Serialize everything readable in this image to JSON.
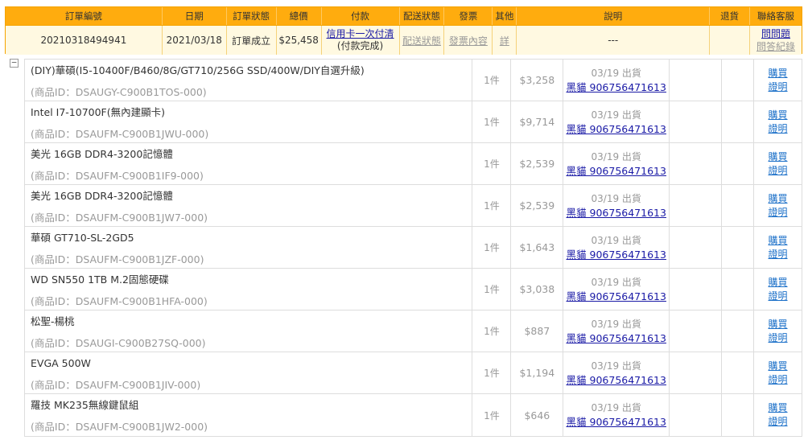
{
  "header": {
    "columns": [
      "訂單編號",
      "日期",
      "訂單狀態",
      "總價",
      "付款",
      "配送狀態",
      "發票",
      "其他",
      "說明",
      "退貨",
      "聯絡客服"
    ],
    "order": {
      "id": "20210318494941",
      "date": "2021/03/18",
      "status": "訂單成立",
      "total": "$25,458",
      "payment_link": "信用卡一次付清",
      "payment_status": "(付款完成)",
      "shipping_link": "配送狀態",
      "invoice_link": "發票內容",
      "other_link": "詳",
      "note": "---",
      "return": "",
      "contact_ask": "問問題",
      "contact_log": "問答紀錄"
    }
  },
  "toggle_symbol": "−",
  "items": [
    {
      "name": "(DIY)華碩(I5-10400F/B460/8G/GT710/256G SSD/400W/DIY自選升級)",
      "sku": "(商品ID：DSAUGY-C900B1TOS-000)",
      "qty": "1件",
      "price": "$3,258",
      "ship_date": "03/19 出貨",
      "tracking": "黑貓 906756471613",
      "buy_again": "購買",
      "proof": "證明"
    },
    {
      "name": "Intel I7-10700F(無內建顯卡)",
      "sku": "(商品ID：DSAUFM-C900B1JWU-000)",
      "qty": "1件",
      "price": "$9,714",
      "ship_date": "03/19 出貨",
      "tracking": "黑貓 906756471613",
      "buy_again": "購買",
      "proof": "證明"
    },
    {
      "name": "美光 16GB DDR4-3200記憶體",
      "sku": "(商品ID：DSAUFM-C900B1IF9-000)",
      "qty": "1件",
      "price": "$2,539",
      "ship_date": "03/19 出貨",
      "tracking": "黑貓 906756471613",
      "buy_again": "購買",
      "proof": "證明"
    },
    {
      "name": "美光 16GB DDR4-3200記憶體",
      "sku": "(商品ID：DSAUFM-C900B1JW7-000)",
      "qty": "1件",
      "price": "$2,539",
      "ship_date": "03/19 出貨",
      "tracking": "黑貓 906756471613",
      "buy_again": "購買",
      "proof": "證明"
    },
    {
      "name": "華碩 GT710-SL-2GD5",
      "sku": "(商品ID：DSAUFM-C900B1JZF-000)",
      "qty": "1件",
      "price": "$1,643",
      "ship_date": "03/19 出貨",
      "tracking": "黑貓 906756471613",
      "buy_again": "購買",
      "proof": "證明"
    },
    {
      "name": "WD SN550 1TB M.2固態硬碟",
      "sku": "(商品ID：DSAUFM-C900B1HFA-000)",
      "qty": "1件",
      "price": "$3,038",
      "ship_date": "03/19 出貨",
      "tracking": "黑貓 906756471613",
      "buy_again": "購買",
      "proof": "證明"
    },
    {
      "name": "松聖-楊桃",
      "sku": "(商品ID：DSAUGI-C900B27SQ-000)",
      "qty": "1件",
      "price": "$887",
      "ship_date": "03/19 出貨",
      "tracking": "黑貓 906756471613",
      "buy_again": "購買",
      "proof": "證明"
    },
    {
      "name": "EVGA 500W",
      "sku": "(商品ID：DSAUFM-C900B1JIV-000)",
      "qty": "1件",
      "price": "$1,194",
      "ship_date": "03/19 出貨",
      "tracking": "黑貓 906756471613",
      "buy_again": "購買",
      "proof": "證明"
    },
    {
      "name": "羅技 MK235無線鍵鼠組",
      "sku": "(商品ID：DSAUFM-C900B1JW2-000)",
      "qty": "1件",
      "price": "$646",
      "ship_date": "03/19 出貨",
      "tracking": "黑貓 906756471613",
      "buy_again": "購買",
      "proof": "證明"
    }
  ]
}
